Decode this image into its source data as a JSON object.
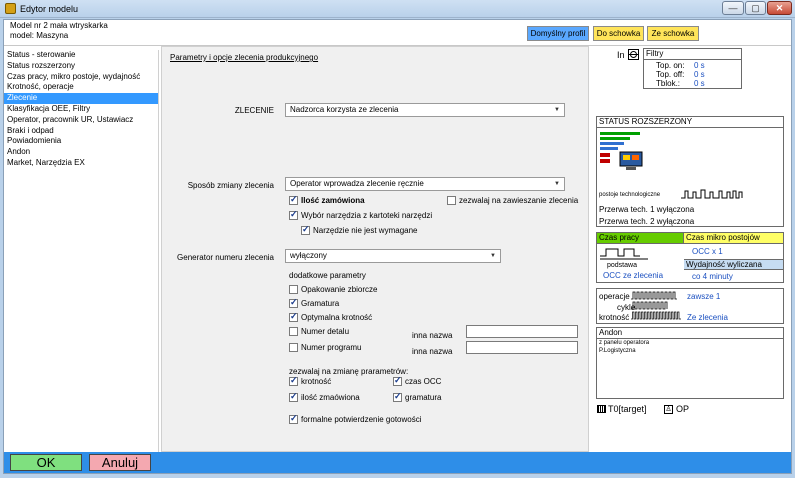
{
  "window": {
    "title": "Edytor modelu",
    "minimize": "—",
    "maximize": "▢",
    "close": "✕"
  },
  "header": {
    "model_line": "Model nr 2  mała wtryskarka",
    "machine_line": "model: Maszyna",
    "btn_default_profile": "Domyślny profil",
    "btn_to_clipboard": "Do schowka",
    "btn_from_clipboard": "Ze schowka"
  },
  "nav": {
    "items": [
      "Status - sterowanie",
      "Status rozszerzony",
      "Czas pracy, mikro postoje, wydajność",
      "Krotność, operacje",
      "Zlecenie",
      "Klasyfikacja OEE, Filtry",
      "Operator, pracownik UR, Ustawiacz",
      "Braki i odpad",
      "Powiadomienia",
      "Andon",
      "Market, Narzędzia EX"
    ],
    "selected_index": 4
  },
  "center": {
    "section_link": "Parametry i opcje zlecenia produkcyjnego",
    "zlecenie_label": "ZLECENIE",
    "zlecenie_value": "Nadzorca korzysta ze zlecenia",
    "change_mode_label": "Sposób zmiany zlecenia",
    "change_mode_value": "Operator wprowadza zlecenie ręcznie",
    "cb_quantity": "Ilość zamówiona",
    "cb_allow_suspend": "zezwalaj na zawieszanie zlecenia",
    "cb_tool_select": "Wybór narzędzia z kartoteki narzędzi",
    "cb_tool_not_required": "Narzędzie nie jest wymagane",
    "generator_label": "Generator numeru zlecenia",
    "generator_value": "wyłączony",
    "extra_params": "dodatkowe parametry",
    "cb_packaging": "Opakowanie zbiorcze",
    "cb_weight": "Gramatura",
    "cb_optimal_mult": "Optymalna krotność",
    "cb_detail_no": "Numer detalu",
    "cb_program_no": "Numer programu",
    "other_name_1": "inna nazwa",
    "other_name_2": "inna nazwa",
    "allow_change": "zezwalaj na zmianę prarametrów:",
    "cb_mult": "krotność",
    "cb_occ": "czas OCC",
    "cb_qty_ordered": "ilość zmaówiona",
    "cb_gram": "gramatura",
    "cb_confirm": "formalne potwierdzenie gotowości"
  },
  "right": {
    "in_label": "In",
    "filters_title": "Filtry",
    "top_on_label": "Top. on:",
    "top_on_value": "0 s",
    "top_off_label": "Top. off:",
    "top_off_value": "0 s",
    "tblok_label": "Tblok.:",
    "tblok_value": "0 s",
    "status_ext_title": "STATUS ROZSZERZONY",
    "tech_stops": "postoje technologiczne",
    "break1": "Przerwa tech. 1 wyłączona",
    "break2": "Przerwa tech. 2 wyłączona",
    "work_time": "Czas pracy",
    "micro_stops": "Czas mikro postojów",
    "base": "podstawa",
    "occ_from_order": "OCC ze zlecenia",
    "occ_x1": "OCC x 1",
    "efficiency_calc": "Wydajność wyliczana",
    "every_4min": "co 4 minuty",
    "ops_label": "operacje",
    "ops_value": "zawsze 1",
    "cycles_label": "cykle",
    "mult_label": "krotność",
    "mult_value": "Ze zlecenia",
    "andon_title": "Andon",
    "andon_line1": "z panelu operatora",
    "andon_line2": "P.Logistyczna",
    "t0_target": "T0[target]",
    "op": "OP"
  },
  "bottom": {
    "ok": "OK",
    "cancel": "Anuluj"
  },
  "colors": {
    "nav_selected": "#3399ff",
    "bottom_bar": "#2e8ee8",
    "ok_button": "#7fe07f",
    "cancel_button": "#f4a8b0",
    "default_profile_button": "#5aa8ff",
    "clipboard_button": "#ffe45a",
    "work_time_header": "#66cc00",
    "micro_stops_header": "#ffff66",
    "efficiency_header": "#c6dcf2"
  }
}
